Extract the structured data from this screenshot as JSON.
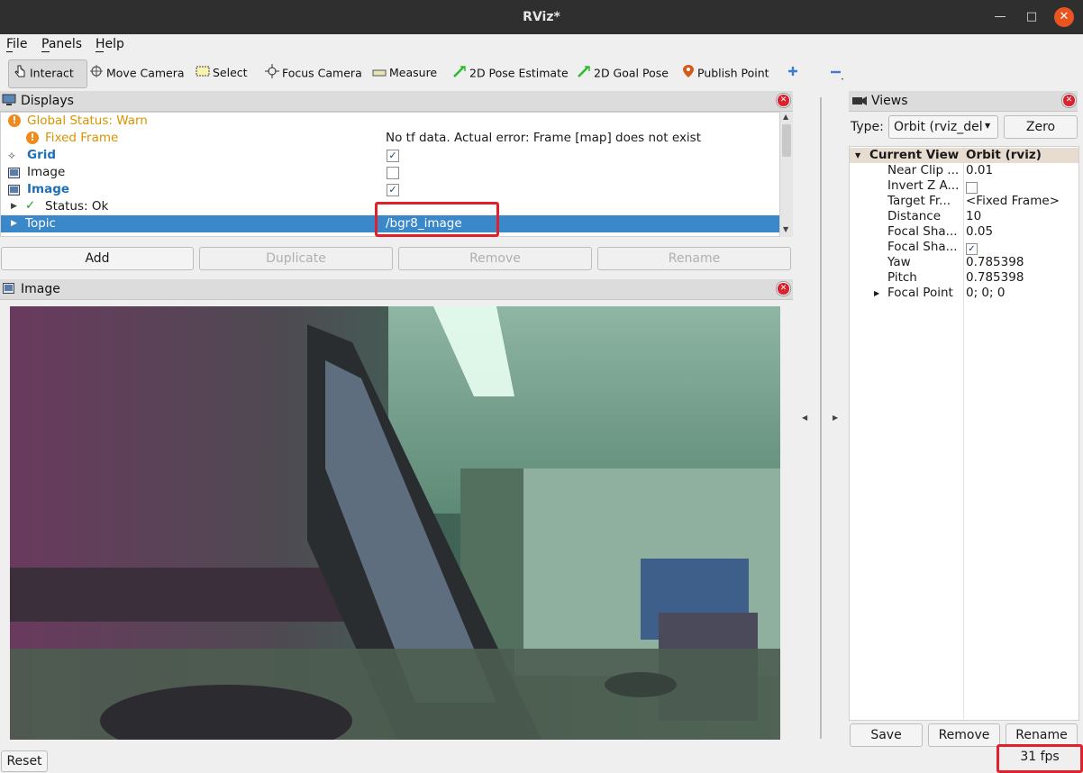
{
  "window": {
    "title": "RViz*"
  },
  "menubar": {
    "file": "File",
    "panels": "Panels",
    "help": "Help"
  },
  "toolbar": {
    "interact": "Interact",
    "move_camera": "Move Camera",
    "select": "Select",
    "focus_camera": "Focus Camera",
    "measure": "Measure",
    "pose_estimate": "2D Pose Estimate",
    "goal_pose": "2D Goal Pose",
    "publish_point": "Publish Point",
    "icons": [
      "plus-icon",
      "minus-icon"
    ]
  },
  "displays": {
    "title": "Displays",
    "rows": {
      "global_status": "Global Status: Warn",
      "fixed_frame": "Fixed Frame",
      "fixed_frame_error": "No tf data.  Actual error: Frame [map] does not exist",
      "grid": "Grid",
      "image1": "Image",
      "image2": "Image",
      "status": "Status: Ok",
      "topic": "Topic",
      "topic_value": "/bgr8_image"
    },
    "checked": {
      "grid": true,
      "image1": false,
      "image2": true
    },
    "buttons": {
      "add": "Add",
      "duplicate": "Duplicate",
      "remove": "Remove",
      "rename": "Rename"
    }
  },
  "image_panel": {
    "title": "Image"
  },
  "views": {
    "title": "Views",
    "type_label": "Type:",
    "type_value": "Orbit (rviz_del",
    "zero": "Zero",
    "header_name": "Current View",
    "header_value": "Orbit (rviz)",
    "props": [
      {
        "name": "Near Clip ...",
        "value": "0.01"
      },
      {
        "name": "Invert Z A...",
        "value": ""
      },
      {
        "name": "Target Fr...",
        "value": "<Fixed Frame>"
      },
      {
        "name": "Distance",
        "value": "10"
      },
      {
        "name": "Focal Sha...",
        "value": "0.05"
      },
      {
        "name": "Focal Sha...",
        "value": ""
      },
      {
        "name": "Yaw",
        "value": "0.785398"
      },
      {
        "name": "Pitch",
        "value": "0.785398"
      },
      {
        "name": "Focal Point",
        "value": "0; 0; 0"
      }
    ],
    "checked": {
      "invert_z": false,
      "focal_shape_fixed": true
    },
    "buttons": {
      "save": "Save",
      "remove": "Remove",
      "rename": "Rename"
    }
  },
  "statusbar": {
    "reset": "Reset",
    "fps": "31 fps"
  },
  "colors": {
    "titlebar": "#2f2f2f",
    "close": "#e95420",
    "selection": "#3a88c9",
    "warn": "#d89400",
    "highlight_box": "#e0202a"
  }
}
